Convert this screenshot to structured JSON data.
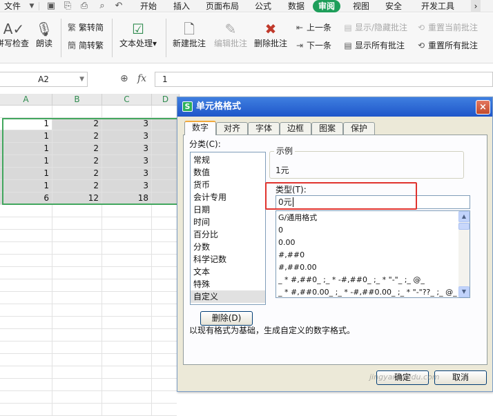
{
  "menubar": {
    "file": "文件",
    "tabs": [
      "开始",
      "插入",
      "页面布局",
      "公式",
      "数据",
      "审阅",
      "视图",
      "安全",
      "开发工具"
    ],
    "active_tab": "审阅",
    "more": "›"
  },
  "ribbon": {
    "spellcheck": "拼写检查",
    "read_aloud": "朗读",
    "trad_to_simp_t": "繁转简",
    "simp_to_trad": "简转繁",
    "text_processing": "文本处理",
    "new_comment": "新建批注",
    "edit_comment": "编辑批注",
    "delete_comment": "删除批注",
    "prev": "上一条",
    "next": "下一条",
    "show_hide_comment": "显示/隐藏批注",
    "show_all_comments": "显示所有批注",
    "reset_current_comment": "重置当前批注",
    "reset_all_comments": "重置所有批注"
  },
  "formula_bar": {
    "name_box": "A2",
    "fx": "fx",
    "value": "1"
  },
  "grid": {
    "columns": [
      "A",
      "B",
      "C",
      "D"
    ],
    "rows": [
      [
        "1",
        "2",
        "3"
      ],
      [
        "1",
        "2",
        "3"
      ],
      [
        "1",
        "2",
        "3"
      ],
      [
        "1",
        "2",
        "3"
      ],
      [
        "1",
        "2",
        "3"
      ],
      [
        "1",
        "2",
        "3"
      ],
      [
        "6",
        "12",
        "18"
      ]
    ]
  },
  "dialog": {
    "title": "单元格格式",
    "app_icon": "S",
    "close": "×",
    "tabs": [
      "数字",
      "对齐",
      "字体",
      "边框",
      "图案",
      "保护"
    ],
    "active_tab": "数字",
    "category_label": "分类(C):",
    "categories": [
      "常规",
      "数值",
      "货币",
      "会计专用",
      "日期",
      "时间",
      "百分比",
      "分数",
      "科学记数",
      "文本",
      "特殊",
      "自定义"
    ],
    "selected_category": "自定义",
    "sample_label": "示例",
    "sample_value": "1元",
    "type_label": "类型(T):",
    "type_value": "0元",
    "format_list": [
      "G/通用格式",
      "0",
      "0.00",
      "#,##0",
      "#,##0.00",
      "_ * #,##0_ ;_ * -#,##0_ ;_ * \"-\"_ ;_ @_",
      "_ * #,##0.00_ ;_ * -#,##0.00_ ;_ * \"-\"??_ ;_ @_"
    ],
    "delete_button": "删除(D)",
    "description": "以现有格式为基础，生成自定义的数字格式。",
    "ok_button": "确定",
    "cancel_button": "取消"
  },
  "watermark": "jingyan.baidu.com",
  "colors": {
    "accent": "#1e9e5a",
    "selection_border": "#41a65d",
    "highlight_box": "#e0322d",
    "dialog_title": "#2a63d4"
  }
}
